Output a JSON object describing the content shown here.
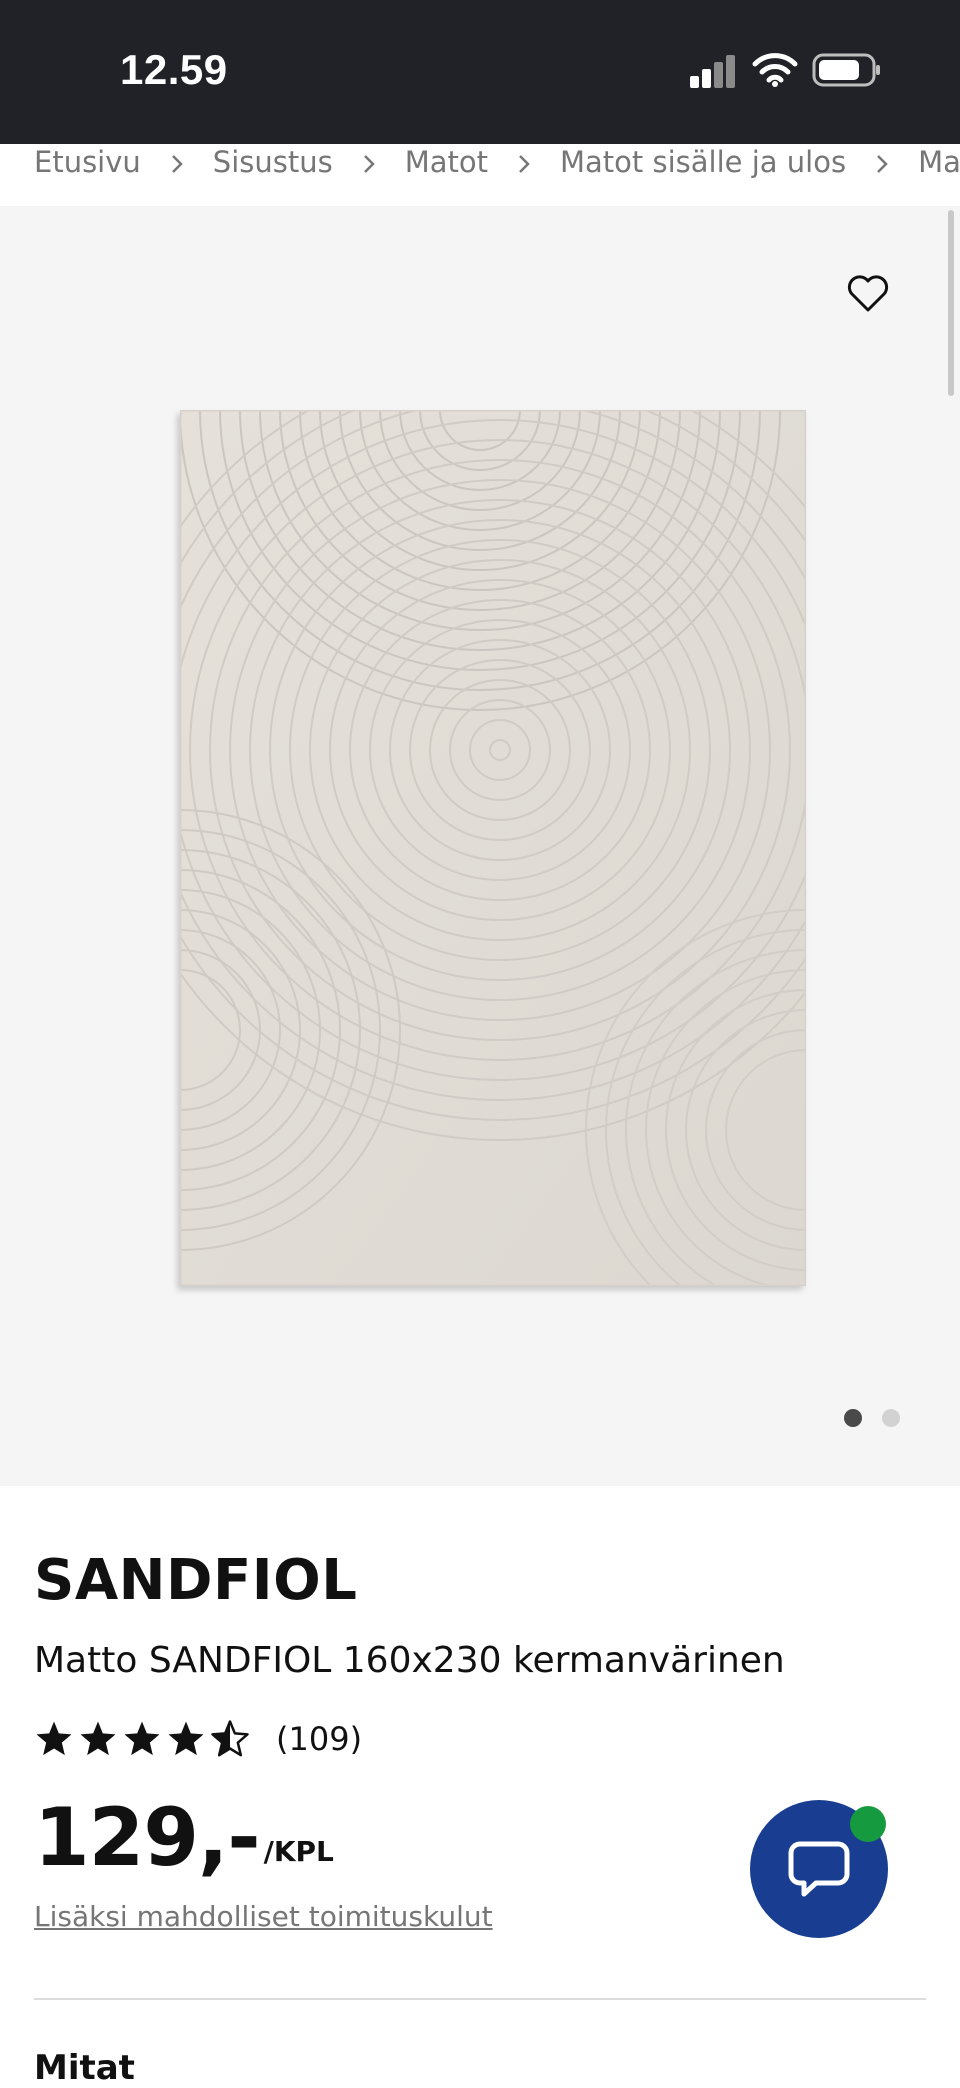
{
  "status_bar": {
    "time": "12.59",
    "icons": [
      "signal-icon",
      "wifi-icon",
      "battery-icon"
    ]
  },
  "breadcrumb": {
    "items": [
      "Etusivu",
      "Sisustus",
      "Matot",
      "Matot sisälle ja ulos",
      "Matto S"
    ]
  },
  "gallery": {
    "image_count": 2,
    "active_index": 0,
    "favorite_icon": "heart-icon"
  },
  "product": {
    "name": "SANDFIOL",
    "description": "Matto SANDFIOL 160x230 kermanvärinen",
    "rating_stars": 4.5,
    "rating_count": "(109)",
    "price": "129,-",
    "price_unit": "/KPL",
    "delivery_note": "Lisäksi mahdolliset toimituskulut"
  },
  "chat": {
    "icon": "chat-bubble-icon",
    "status_color": "#159a3f",
    "button_color": "#193d91"
  },
  "next_section": {
    "title": "Mitat"
  }
}
